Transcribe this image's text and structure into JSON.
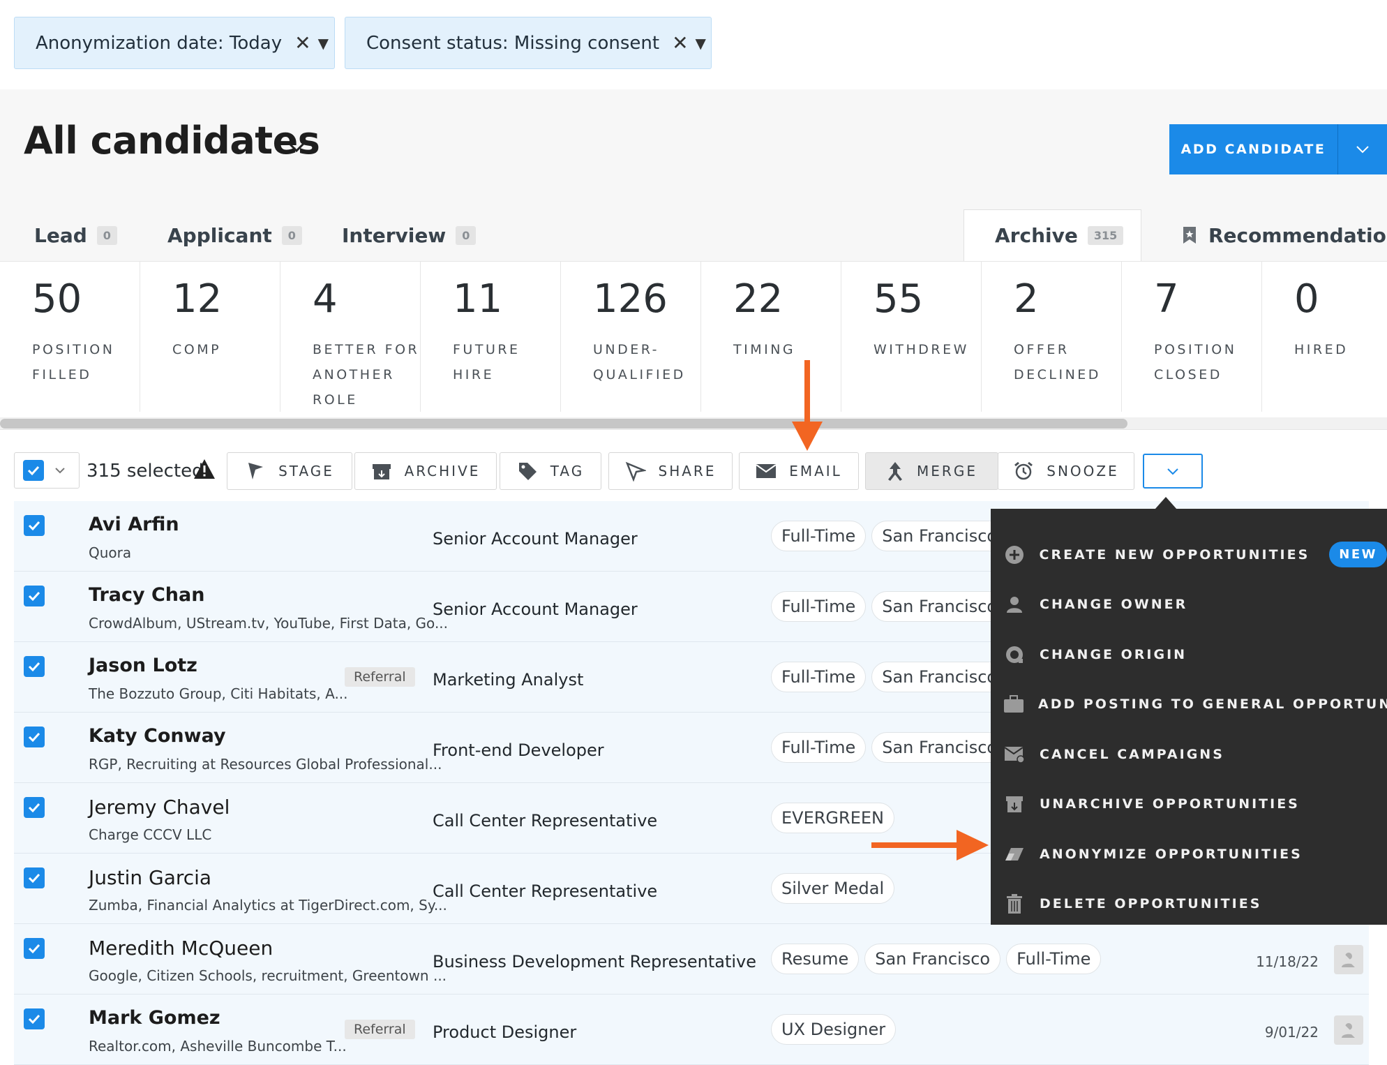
{
  "filters": [
    {
      "label": "Anonymization date: Today"
    },
    {
      "label": "Consent status: Missing consent"
    }
  ],
  "page_title": "All candidates",
  "add_candidate_label": "ADD CANDIDATE",
  "tabs": [
    {
      "label": "Lead",
      "count": "0"
    },
    {
      "label": "Applicant",
      "count": "0"
    },
    {
      "label": "Interview",
      "count": "0"
    },
    {
      "label": "Archive",
      "count": "315"
    },
    {
      "label": "Recommendations"
    }
  ],
  "reasons": [
    {
      "count": "50",
      "label": "POSITION FILLED"
    },
    {
      "count": "12",
      "label": "COMP"
    },
    {
      "count": "4",
      "label": "BETTER FOR ANOTHER ROLE"
    },
    {
      "count": "11",
      "label": "FUTURE HIRE"
    },
    {
      "count": "126",
      "label": "UNDER- QUALIFIED"
    },
    {
      "count": "22",
      "label": "TIMING"
    },
    {
      "count": "55",
      "label": "WITHDREW"
    },
    {
      "count": "2",
      "label": "OFFER DECLINED"
    },
    {
      "count": "7",
      "label": "POSITION CLOSED"
    },
    {
      "count": "0",
      "label": "HIRED"
    }
  ],
  "toolbar": {
    "selected_text": "315 selected",
    "stage": "STAGE",
    "archive": "ARCHIVE",
    "tag": "TAG",
    "share": "SHARE",
    "email": "EMAIL",
    "merge": "MERGE",
    "snooze": "SNOOZE"
  },
  "candidates": [
    {
      "name": "Avi Arfin",
      "company": "Quora",
      "role": "Senior Account Manager",
      "tags": [
        "Full-Time",
        "San Francisco"
      ]
    },
    {
      "name": "Tracy Chan",
      "company": "CrowdAlbum, UStream.tv, YouTube, First Data, Go...",
      "role": "Senior Account Manager",
      "tags": [
        "Full-Time",
        "San Francisco"
      ]
    },
    {
      "name": "Jason Lotz",
      "company": "The Bozzuto Group, Citi Habitats, A...",
      "referral": "Referral",
      "role": "Marketing Analyst",
      "tags": [
        "Full-Time",
        "San Francisco"
      ]
    },
    {
      "name": "Katy Conway",
      "company": "RGP, Recruiting at Resources Global Professional...",
      "role": "Front-end Developer",
      "tags": [
        "Full-Time",
        "San Francisco"
      ]
    },
    {
      "name": "Jeremy Chavel",
      "company": "Charge CCCV LLC",
      "role": "Call Center Representative",
      "tags": [
        "EVERGREEN"
      ]
    },
    {
      "name": "Justin Garcia",
      "company": "Zumba, Financial Analytics at TigerDirect.com, Sy...",
      "role": "Call Center Representative",
      "tags": [
        "Silver Medal"
      ]
    },
    {
      "name": "Meredith McQueen",
      "company": "Google, Citizen Schools, recruitment, Greentown ...",
      "role": "Business Development Representative",
      "tags": [
        "Resume",
        "San Francisco",
        "Full-Time"
      ],
      "date": "11/18/22"
    },
    {
      "name": "Mark Gomez",
      "company": "Realtor.com, Asheville Buncombe T...",
      "referral": "Referral",
      "role": "Product Designer",
      "tags": [
        "UX Designer"
      ],
      "date": "9/01/22"
    }
  ],
  "menu": {
    "new_badge": "NEW",
    "items": [
      {
        "label": "CREATE NEW OPPORTUNITIES",
        "icon": "plus-circle-icon"
      },
      {
        "label": "CHANGE OWNER",
        "icon": "person-icon"
      },
      {
        "label": "CHANGE ORIGIN",
        "icon": "origin-icon"
      },
      {
        "label": "ADD POSTING TO GENERAL OPPORTUNITIES",
        "icon": "briefcase-icon"
      },
      {
        "label": "CANCEL CAMPAIGNS",
        "icon": "mail-cancel-icon"
      },
      {
        "label": "UNARCHIVE OPPORTUNITIES",
        "icon": "unarchive-icon"
      },
      {
        "label": "ANONYMIZE OPPORTUNITIES",
        "icon": "eraser-icon"
      },
      {
        "label": "DELETE OPPORTUNITIES",
        "icon": "trash-icon"
      }
    ]
  },
  "colors": {
    "accent": "#1b8ae8",
    "annotation_arrow": "#f26522",
    "menu_bg": "#2d2d2d"
  }
}
